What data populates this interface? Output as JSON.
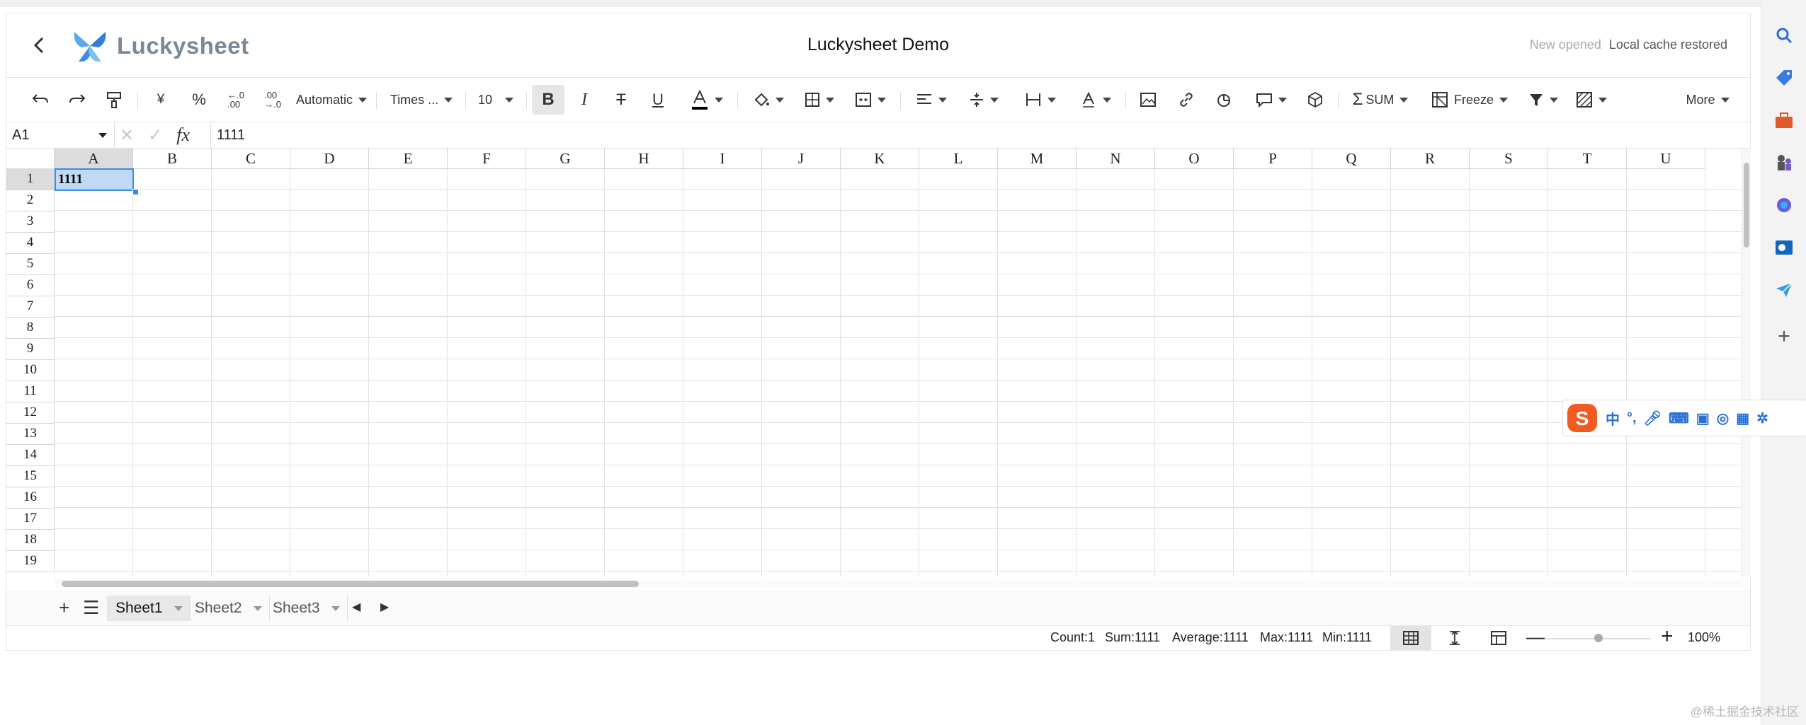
{
  "header": {
    "back_icon": "chevron-left-icon",
    "logo_text": "Luckysheet",
    "title": "Luckysheet Demo",
    "status_prefix": "New opened",
    "status_text": "Local cache restored"
  },
  "toolbar": {
    "number_format": "Automatic",
    "font_family": "Times ...",
    "font_size": "10",
    "currency": "¥",
    "percent": "%",
    "sum_label": "SUM",
    "freeze_label": "Freeze",
    "more_label": "More"
  },
  "formula_bar": {
    "cell_ref": "A1",
    "fx_label": "fx",
    "value": "1111"
  },
  "grid": {
    "columns": [
      "A",
      "B",
      "C",
      "D",
      "E",
      "F",
      "G",
      "H",
      "I",
      "J",
      "K",
      "L",
      "M",
      "N",
      "O",
      "P",
      "Q",
      "R",
      "S",
      "T",
      "U"
    ],
    "rows": [
      "1",
      "2",
      "3",
      "4",
      "5",
      "6",
      "7",
      "8",
      "9",
      "10",
      "11",
      "12",
      "13",
      "14",
      "15",
      "16",
      "17",
      "18",
      "19"
    ],
    "cell_A1": "1111"
  },
  "sheets": {
    "tabs": [
      "Sheet1",
      "Sheet2",
      "Sheet3"
    ],
    "active": "Sheet1"
  },
  "status": {
    "count": "Count:1",
    "sum": "Sum:1111",
    "average": "Average:1111",
    "max": "Max:1111",
    "min": "Min:1111",
    "zoom": "100%"
  },
  "ime": {
    "lang": "中",
    "punct": "°,"
  },
  "watermark": "@稀土掘金技术社区",
  "colors": {
    "selection": "#3a8ee6",
    "logo_blue": "#3a8ee6"
  }
}
